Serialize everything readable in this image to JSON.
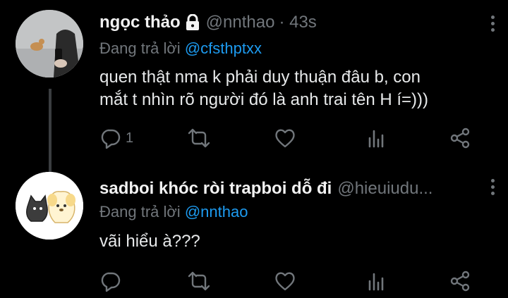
{
  "tweets": [
    {
      "name": "ngọc thảo",
      "handle": "@nnthao",
      "time": "· 43s",
      "locked": true,
      "reply_prefix": "Đang trả lời ",
      "reply_to": "@cfsthptxx",
      "text_line1": "quen thật nma k phải duy thuận đâu b, con",
      "text_line2": "mắt t nhìn rõ người đó là anh trai tên H í=)))",
      "reply_count": "1",
      "retweet_count": "",
      "like_count": ""
    },
    {
      "name": "sadboi khóc ròi trapboi dỗ đi",
      "handle": "@hieuiudu...",
      "reply_prefix": "Đang trả lời ",
      "reply_to": "@nnthao",
      "text_line1": "vãi hiểu à???",
      "reply_count": "",
      "retweet_count": "",
      "like_count": ""
    }
  ],
  "colors": {
    "background": "#000000",
    "text": "#e7e9ea",
    "muted": "#71767b",
    "link": "#1d9bf0"
  },
  "icons": [
    "lock-icon",
    "reply-icon",
    "retweet-icon",
    "like-icon",
    "views-icon",
    "share-icon",
    "more-icon"
  ]
}
